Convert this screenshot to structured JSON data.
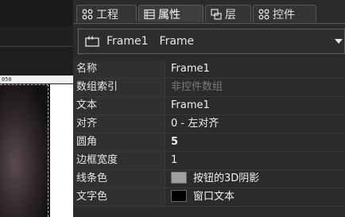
{
  "canvas": {
    "ruler_label": "050"
  },
  "tabs": [
    {
      "label": "工程",
      "icon": "project-icon",
      "active": false
    },
    {
      "label": "属性",
      "icon": "properties-icon",
      "active": true
    },
    {
      "label": "层",
      "icon": "layers-icon",
      "active": false
    },
    {
      "label": "控件",
      "icon": "controls-icon",
      "active": false
    }
  ],
  "selector": {
    "name": "Frame1",
    "type": "Frame"
  },
  "properties": [
    {
      "label": "名称",
      "value": "Frame1"
    },
    {
      "label": "数组索引",
      "value": "非控件数组"
    },
    {
      "label": "文本",
      "value": "Frame1"
    },
    {
      "label": "对齐",
      "value": "0 - 左对齐"
    },
    {
      "label": "圆角",
      "value": "5"
    },
    {
      "label": "边框宽度",
      "value": "1"
    },
    {
      "label": "线条色",
      "value": "按钮的3D阴影",
      "swatch": "#a0a0a0"
    },
    {
      "label": "文字色",
      "value": "窗口文本",
      "swatch": "#000000"
    }
  ]
}
